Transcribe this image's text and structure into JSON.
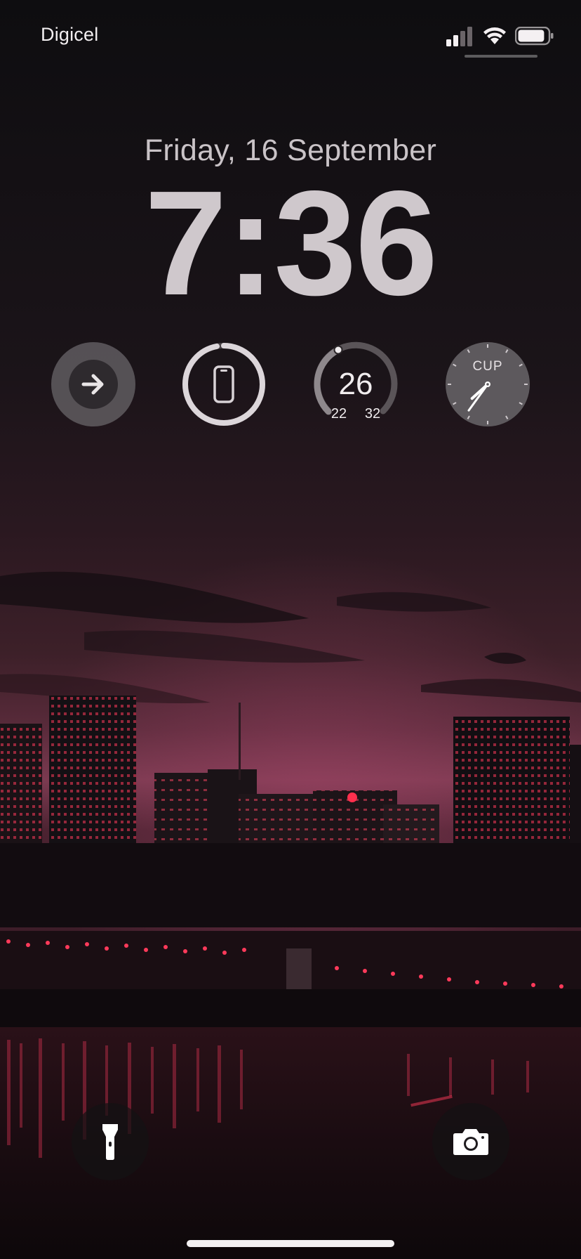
{
  "status_bar": {
    "carrier": "Digicel",
    "signal_bars_active": 2,
    "signal_bars_total": 4,
    "battery_level": 0.9,
    "signal_icon": "cellular-signal-icon",
    "wifi_icon": "wifi-icon",
    "battery_icon": "battery-icon"
  },
  "lock_screen": {
    "date": "Friday, 16 September",
    "time": "7:36"
  },
  "widgets": {
    "shortcut": {
      "icon": "arrow-right-icon"
    },
    "battery": {
      "icon": "iphone-icon",
      "level": 0.97
    },
    "weather": {
      "temperature": "26",
      "low": "22",
      "high": "32",
      "position": 0.4
    },
    "world_clock": {
      "city": "CUP",
      "hour": 7,
      "minute": 36
    }
  },
  "quick_actions": {
    "flashlight_icon": "flashlight-icon",
    "camera_icon": "camera-icon"
  },
  "colors": {
    "sky_top": "#121013",
    "sky_glow": "#8a3a55",
    "city_lights": "#ff2f4d",
    "text": "#d4ced2"
  }
}
